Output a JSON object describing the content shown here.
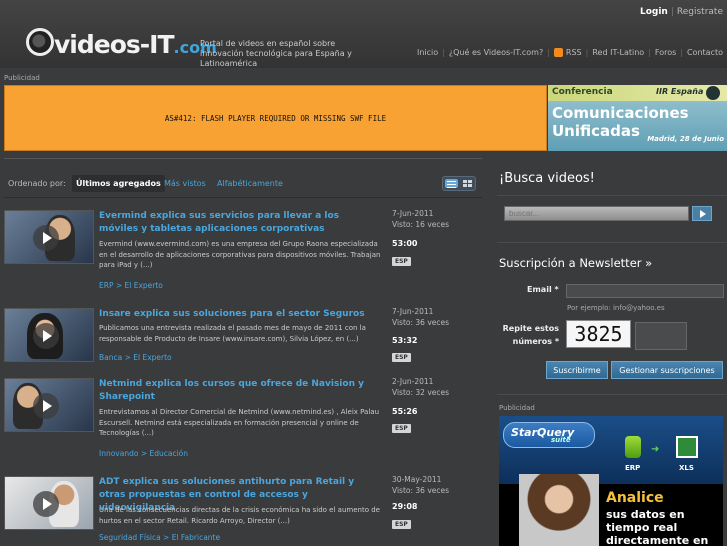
{
  "header": {
    "logo_main": "videos-IT",
    "logo_suffix": ".com",
    "tagline": "Portal de videos en español sobre innovación tecnológica para España y Latinoamérica",
    "login": "Login",
    "separator": "|",
    "register": "Registrate",
    "nav": [
      "Inicio",
      "¿Qué es Videos-IT.com?",
      "RSS",
      "Red IT-Latino",
      "Foros",
      "Contacto"
    ]
  },
  "ads": {
    "label": "Publicidad",
    "flash_error": "AS#412: FLASH PLAYER REQUIRED OR MISSING SWF FILE",
    "top_banner": {
      "kicker": "Conferencia",
      "brand": "IIR España",
      "line1": "Comunicaciones",
      "line2": "Unificadas",
      "date": "Madrid, 28 de Junio"
    },
    "side_label": "Publicidad",
    "side_banner": {
      "product": "StarQuery",
      "product_sub": "suite",
      "from_label": "ERP",
      "to_label": "XLS",
      "headline": "Analice",
      "body": "sus datos en tiempo real directamente en Excel"
    }
  },
  "sort": {
    "label": "Ordenado por:",
    "active": "Últimos agregados",
    "options": [
      "Más vistos",
      "Alfabéticamente"
    ]
  },
  "videos": [
    {
      "title": "Evermind explica sus servicios para llevar a los móviles y tabletas aplicaciones corporativas",
      "description": "Evermind (www.evermind.com) es una empresa del Grupo Raona especializada en el desarrollo de aplicaciones corporativas para dispositivos móviles. Trabajan para iPad y (...)",
      "category": "ERP > El Experto",
      "date": "7-Jun-2011",
      "views": "Visto: 16 veces",
      "duration": "53:00",
      "lang": "ESP"
    },
    {
      "title": "Insare explica sus soluciones para el sector Seguros",
      "description": "Publicamos una entrevista realizada el pasado mes de mayo de 2011 con la responsable de Producto de Insare (www.insare.com), Silvia López, en (...)",
      "category": "Banca > El Experto",
      "date": "7-Jun-2011",
      "views": "Visto: 36 veces",
      "duration": "53:32",
      "lang": "ESP"
    },
    {
      "title": "Netmind explica los cursos que ofrece de Navision y Sharepoint",
      "description": "Entrevistamos al Director Comercial de Netmind (www.netmind.es) , Aleix Palau Escursell. Netmind está especializada en formación presencial y online de Tecnologías (...)",
      "category": "Innovando > Educación",
      "date": "2-Jun-2011",
      "views": "Visto: 32 veces",
      "duration": "55:26",
      "lang": "ESP"
    },
    {
      "title": "ADT explica sus soluciones antihurto para Retail y otras propuestas en control de accesos y videovigilancia",
      "description": "Una de las consecuencias directas de la crisis económica ha sido el aumento de hurtos en el sector Retail. Ricardo Arroyo, Director (...)",
      "category": "Seguridad Física > El Fabricante",
      "date": "30-May-2011",
      "views": "Visto: 36 veces",
      "duration": "29:08",
      "lang": "ESP"
    }
  ],
  "search": {
    "title": "¡Busca videos!",
    "placeholder": "buscar..."
  },
  "newsletter": {
    "title": "Suscripción a Newsletter »",
    "email_label": "Email",
    "required_mark": "*",
    "email_hint": "Por ejemplo: info@yahoo.es",
    "repeat_label_1": "Repite estos",
    "repeat_label_2": "números",
    "captcha": "3825",
    "subscribe": "Suscribirme",
    "manage": "Gestionar suscripciones"
  },
  "colors": {
    "accent": "#4aa6de",
    "flash_bg": "#f8a233",
    "background": "#3a3b3c"
  }
}
